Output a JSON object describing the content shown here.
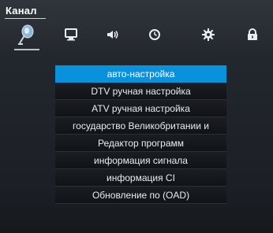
{
  "window": {
    "title": "Канал"
  },
  "tabs": [
    {
      "icon": "satellite-dish-icon"
    },
    {
      "icon": "monitor-icon"
    },
    {
      "icon": "speaker-icon"
    },
    {
      "icon": "clock-icon"
    },
    {
      "icon": "gear-icon"
    },
    {
      "icon": "lock-icon"
    }
  ],
  "menu": {
    "selected_index": 0,
    "items": [
      {
        "label": "авто-настройка"
      },
      {
        "label": "DTV  ручная настройка"
      },
      {
        "label": "ATV  ручная настройка"
      },
      {
        "label": "государство Великобритании и"
      },
      {
        "label": "Редактор программ"
      },
      {
        "label": "информация сигнала"
      },
      {
        "label": "информация CI"
      },
      {
        "label": "Обновление по (OAD)"
      }
    ]
  },
  "colors": {
    "highlight": "#0A91DC",
    "text": "#E8ECF0"
  }
}
